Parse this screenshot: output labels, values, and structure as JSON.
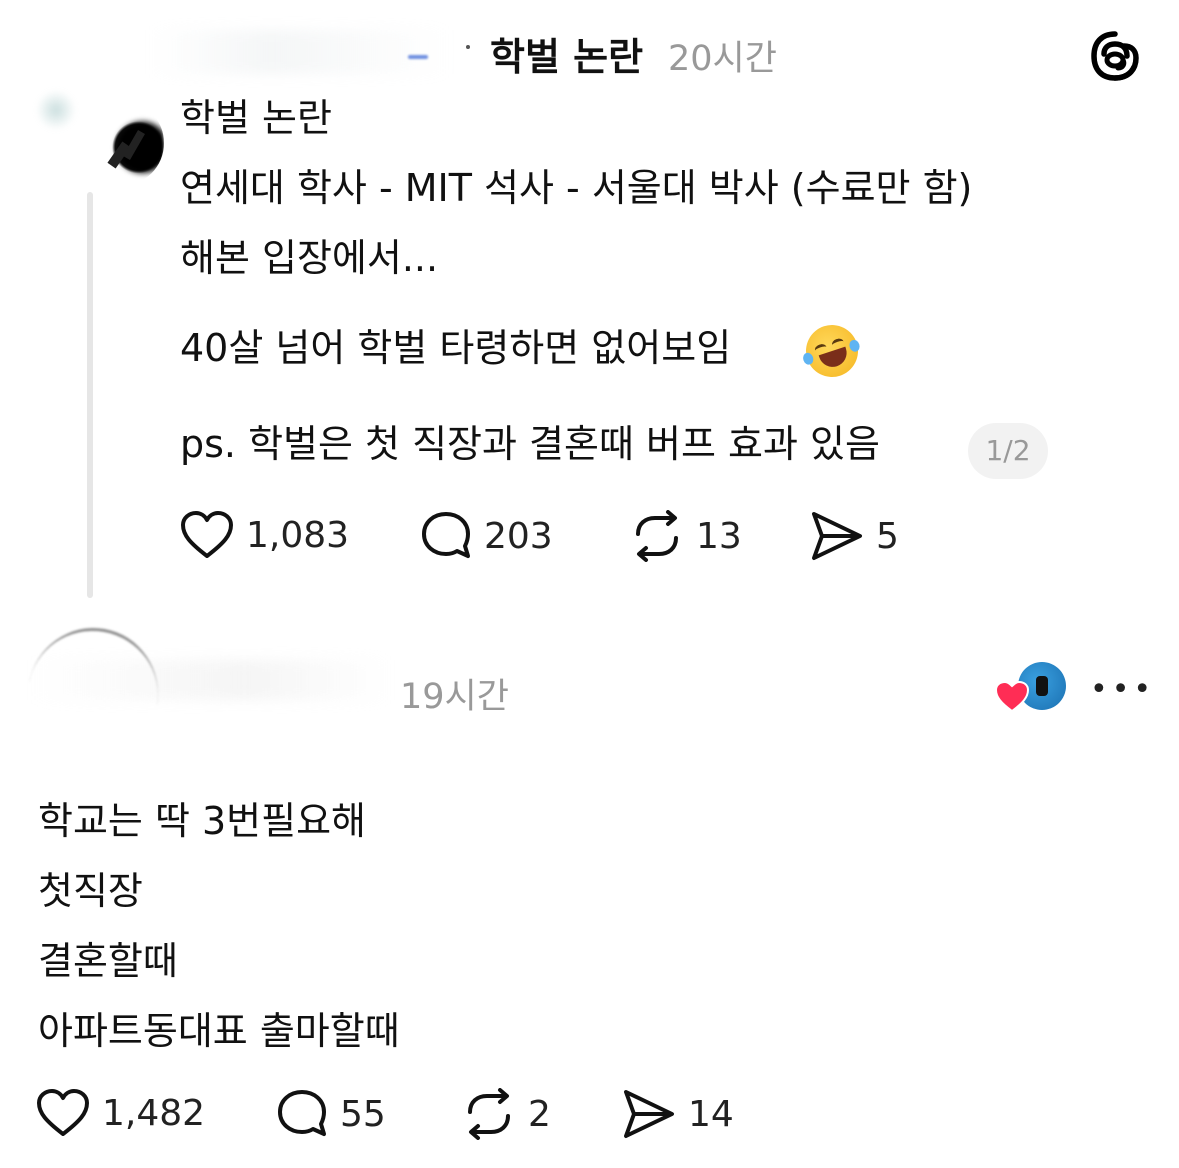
{
  "post": {
    "header_title": "학벌 논란",
    "header_time": "20시간",
    "title_line": "학벌 논란",
    "body_line1": "연세대 학사 - MIT 석사 - 서울대 박사 (수료만 함)",
    "body_line2": "해본 입장에서...",
    "body_line3": "40살 넘어 학벌 타령하면 없어보임",
    "emoji": "rolling-on-floor-laughing",
    "body_line4": "ps. 학벌은 첫 직장과 결혼때 버프 효과 있음",
    "page_indicator": "1/2",
    "likes": "1,083",
    "comments": "203",
    "reposts": "13",
    "shares": "5"
  },
  "reply": {
    "time": "19시간",
    "line1": "학교는 딱 3번필요해",
    "line2": "첫직장",
    "line3": "결혼할때",
    "line4": "아파트동대표 출마할때",
    "likes": "1,482",
    "comments": "55",
    "reposts": "2",
    "shares": "14",
    "more": "•••"
  },
  "icons": {
    "app_logo": "threads-logo-icon",
    "like": "heart-icon",
    "comment": "comment-bubble-icon",
    "repost": "repost-icon",
    "share": "send-icon",
    "more": "more-icon"
  },
  "colors": {
    "text": "#111111",
    "muted": "#999999",
    "badge_bg": "#f2f2f2",
    "like_red": "#ff2d55"
  }
}
